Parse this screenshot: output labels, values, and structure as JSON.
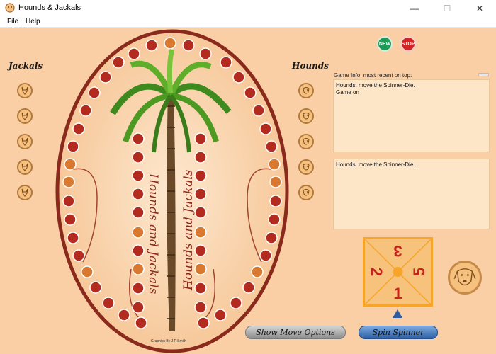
{
  "window": {
    "title": "Hounds & Jackals",
    "minimize": "—",
    "maximize": "☐",
    "close": "✕"
  },
  "menu": {
    "file": "File",
    "help": "Help"
  },
  "labels": {
    "jackals": "Jackals",
    "hounds": "Hounds"
  },
  "controls": {
    "new": "NEW",
    "stop": "STOP"
  },
  "game_info": {
    "label": "Game Info, most recent on top:",
    "log_lines": [
      "Hounds, move the Spinner-Die.",
      "Game on"
    ],
    "status": "Hounds, move the Spinner-Die."
  },
  "spinner": {
    "top": "3",
    "left": "2",
    "right": "5",
    "bottom": "1"
  },
  "buttons": {
    "show_move_options": "Show Move Options",
    "spin_spinner": "Spin Spinner"
  },
  "board": {
    "title_left": "Hounds and Jackals",
    "title_right": "Hounds and Jackals",
    "credit": "Graphics By J P Smith"
  },
  "colors": {
    "background": "#fbcfa6",
    "board_rim": "#8a2a1c",
    "hole": "#b32a1e",
    "hole_marked": "#d9782f",
    "spin_button": "#2d5fa5"
  },
  "icons": {
    "jackal_token": "jackal-icon",
    "hound_token": "hound-icon",
    "palm": "palm-tree-icon"
  }
}
